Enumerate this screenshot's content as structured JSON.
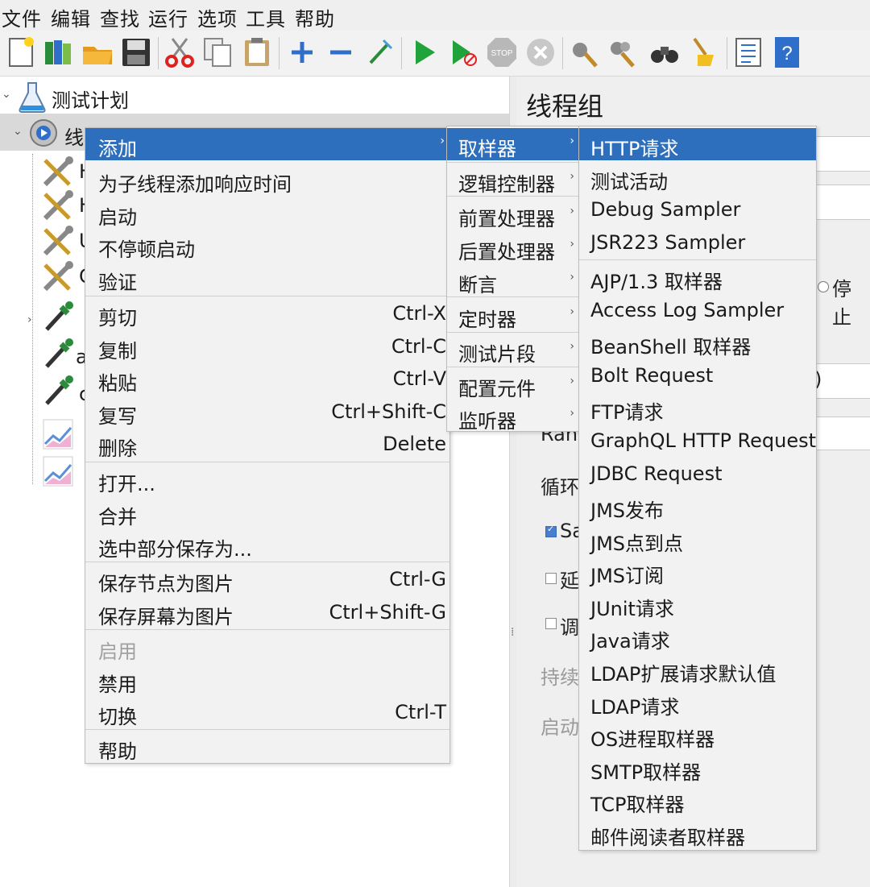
{
  "menubar": [
    "文件",
    "编辑",
    "查找",
    "运行",
    "选项",
    "工具",
    "帮助"
  ],
  "toolbar": [
    "new-icon",
    "templates-icon",
    "open-icon",
    "save-icon",
    "cut-icon",
    "copy-icon",
    "paste-icon",
    "expand-icon",
    "collapse-icon",
    "toggle-icon",
    "start-icon",
    "start-no-pauses-icon",
    "stop-icon",
    "shutdown-icon",
    "clear-icon",
    "clear-all-icon",
    "search-icon",
    "reset-search-icon",
    "function-helper-icon",
    "help-icon"
  ],
  "toolbar_stop_text": "STOP",
  "tree": {
    "root": "测试计划",
    "thread_group": "线程组",
    "partial_labels": [
      "H",
      "H",
      "U",
      "C",
      "",
      "",
      " a",
      "c",
      "",
      "",
      ""
    ]
  },
  "panel": {
    "title": "线程组",
    "radio_stop": "停止",
    "paren": ")",
    "ramp_partial": "Ran",
    "loop_partial": "循环",
    "same_user_partial": "Sa",
    "delay_partial": "延",
    "scheduler_partial": "调",
    "duration_partial": "持续",
    "startup_partial": "启动"
  },
  "context_menu": {
    "items": [
      {
        "label": "添加",
        "shortcut": "",
        "submenu": true
      },
      {
        "label": "为子线程添加响应时间",
        "shortcut": ""
      },
      {
        "label": "启动",
        "shortcut": ""
      },
      {
        "label": "不停顿启动",
        "shortcut": ""
      },
      {
        "label": "验证",
        "shortcut": ""
      },
      {
        "label": "剪切",
        "shortcut": "Ctrl-X"
      },
      {
        "label": "复制",
        "shortcut": "Ctrl-C"
      },
      {
        "label": "粘贴",
        "shortcut": "Ctrl-V"
      },
      {
        "label": "复写",
        "shortcut": "Ctrl+Shift-C"
      },
      {
        "label": "删除",
        "shortcut": "Delete"
      },
      {
        "label": "打开...",
        "shortcut": ""
      },
      {
        "label": "合并",
        "shortcut": ""
      },
      {
        "label": "选中部分保存为...",
        "shortcut": ""
      },
      {
        "label": "保存节点为图片",
        "shortcut": "Ctrl-G"
      },
      {
        "label": "保存屏幕为图片",
        "shortcut": "Ctrl+Shift-G"
      },
      {
        "label": "启用",
        "shortcut": ""
      },
      {
        "label": "禁用",
        "shortcut": ""
      },
      {
        "label": "切换",
        "shortcut": "Ctrl-T"
      },
      {
        "label": "帮助",
        "shortcut": ""
      }
    ]
  },
  "add_submenu": [
    "取样器",
    "逻辑控制器",
    "前置处理器",
    "后置处理器",
    "断言",
    "定时器",
    "测试片段",
    "配置元件",
    "监听器"
  ],
  "sampler_submenu": [
    "HTTP请求",
    "测试活动",
    "Debug Sampler",
    "JSR223 Sampler",
    "AJP/1.3 取样器",
    "Access Log Sampler",
    "BeanShell 取样器",
    "Bolt Request",
    "FTP请求",
    "GraphQL HTTP Request",
    "JDBC Request",
    "JMS发布",
    "JMS点到点",
    "JMS订阅",
    "JUnit请求",
    "Java请求",
    "LDAP扩展请求默认值",
    "LDAP请求",
    "OS进程取样器",
    "SMTP取样器",
    "TCP取样器",
    "邮件阅读者取样器"
  ],
  "colors": {
    "selection": "#2e6fbd",
    "menu_bg": "#f2f2f2",
    "tree_bg": "#ffffff"
  }
}
